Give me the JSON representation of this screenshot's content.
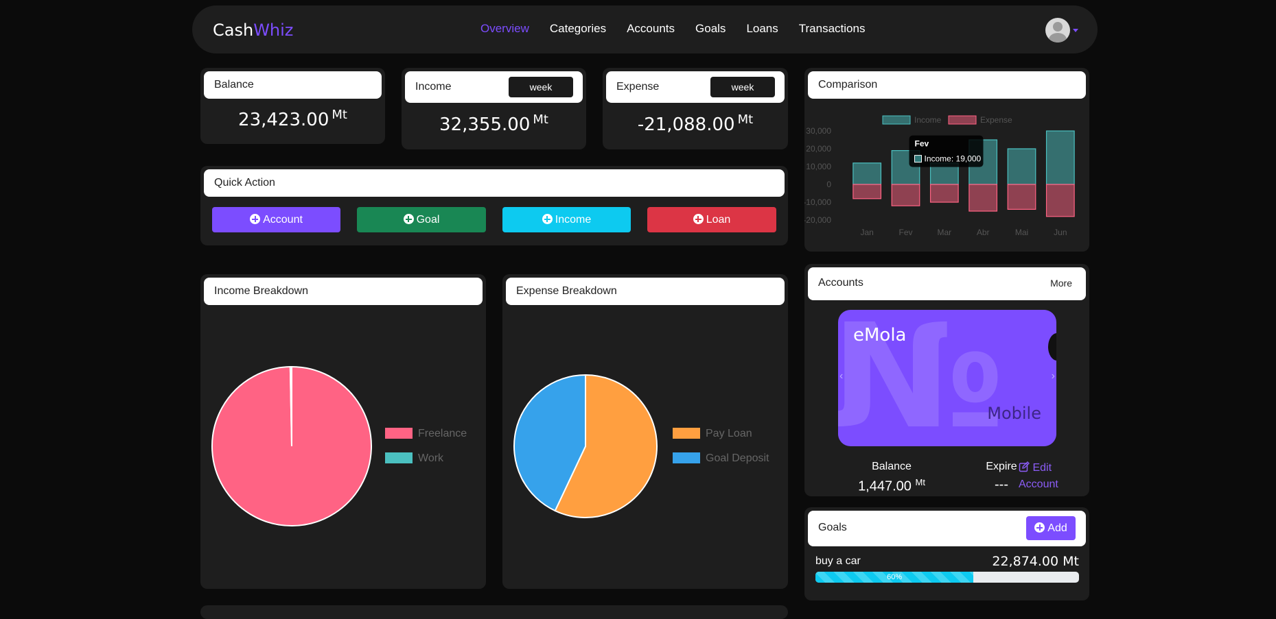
{
  "navbar": {
    "brand_part1": "Cash",
    "brand_part2": "Whiz",
    "links": [
      "Overview",
      "Categories",
      "Accounts",
      "Goals",
      "Loans",
      "Transactions"
    ]
  },
  "stats": {
    "balance": {
      "title": "Balance",
      "value": "23,423.00",
      "unit": "Mt"
    },
    "income": {
      "title": "Income",
      "filter": "week",
      "value": "32,355.00",
      "unit": "Mt"
    },
    "expense": {
      "title": "Expense",
      "filter": "week",
      "value": "-21,088.00",
      "unit": "Mt"
    }
  },
  "quick_action": {
    "title": "Quick Action",
    "buttons": [
      {
        "label": "Account",
        "color": "#7c4dff"
      },
      {
        "label": "Goal",
        "color": "#198754"
      },
      {
        "label": "Income",
        "color": "#0dcaf0"
      },
      {
        "label": "Loan",
        "color": "#dc3545"
      }
    ]
  },
  "income_breakdown": {
    "title": "Income Breakdown"
  },
  "expense_breakdown": {
    "title": "Expense Breakdown"
  },
  "comparison": {
    "title": "Comparison"
  },
  "chart_data": [
    {
      "type": "pie",
      "categories": [
        "Freelance",
        "Work"
      ],
      "values": [
        99.7,
        0.3
      ],
      "colors": [
        "#ff6384",
        "#4bc0c0"
      ],
      "legend": "right"
    },
    {
      "type": "pie",
      "categories": [
        "Pay Loan",
        "Goal Deposit"
      ],
      "values": [
        57,
        43
      ],
      "colors": [
        "#ff9f40",
        "#36a2eb"
      ],
      "legend": "right"
    },
    {
      "type": "bar",
      "categories": [
        "Jan",
        "Fev",
        "Mar",
        "Abr",
        "Mai",
        "Jun"
      ],
      "series": [
        {
          "name": "Income",
          "values": [
            12000,
            19000,
            12000,
            25000,
            20000,
            30000
          ],
          "color": "#4bc0c0"
        },
        {
          "name": "Expense",
          "values": [
            -8000,
            -12000,
            -10000,
            -15000,
            -14000,
            -18000
          ],
          "color": "#ff6384"
        }
      ],
      "ylim": [
        -20000,
        30000
      ],
      "yticks": [
        "30,000",
        "20,000",
        "10,000",
        "0",
        "-10,000",
        "-20,000"
      ],
      "legend": "top",
      "tooltip": {
        "title": "Fev",
        "label": "Income: 19,000"
      }
    }
  ],
  "accounts": {
    "title": "Accounts",
    "more_label": "More",
    "card": {
      "name": "eMola",
      "type": "Mobile"
    },
    "balance_label": "Balance",
    "balance_value": "1,447.00",
    "balance_unit": "Mt",
    "expire_label": "Expire",
    "expire_value": "---",
    "edit_line1": "Edit",
    "edit_line2": "Account"
  },
  "goals": {
    "title": "Goals",
    "add_label": "Add",
    "items": [
      {
        "name": "buy a car",
        "amount": "22,874.00 Mt",
        "progress": 60,
        "progress_label": "60%"
      }
    ]
  }
}
